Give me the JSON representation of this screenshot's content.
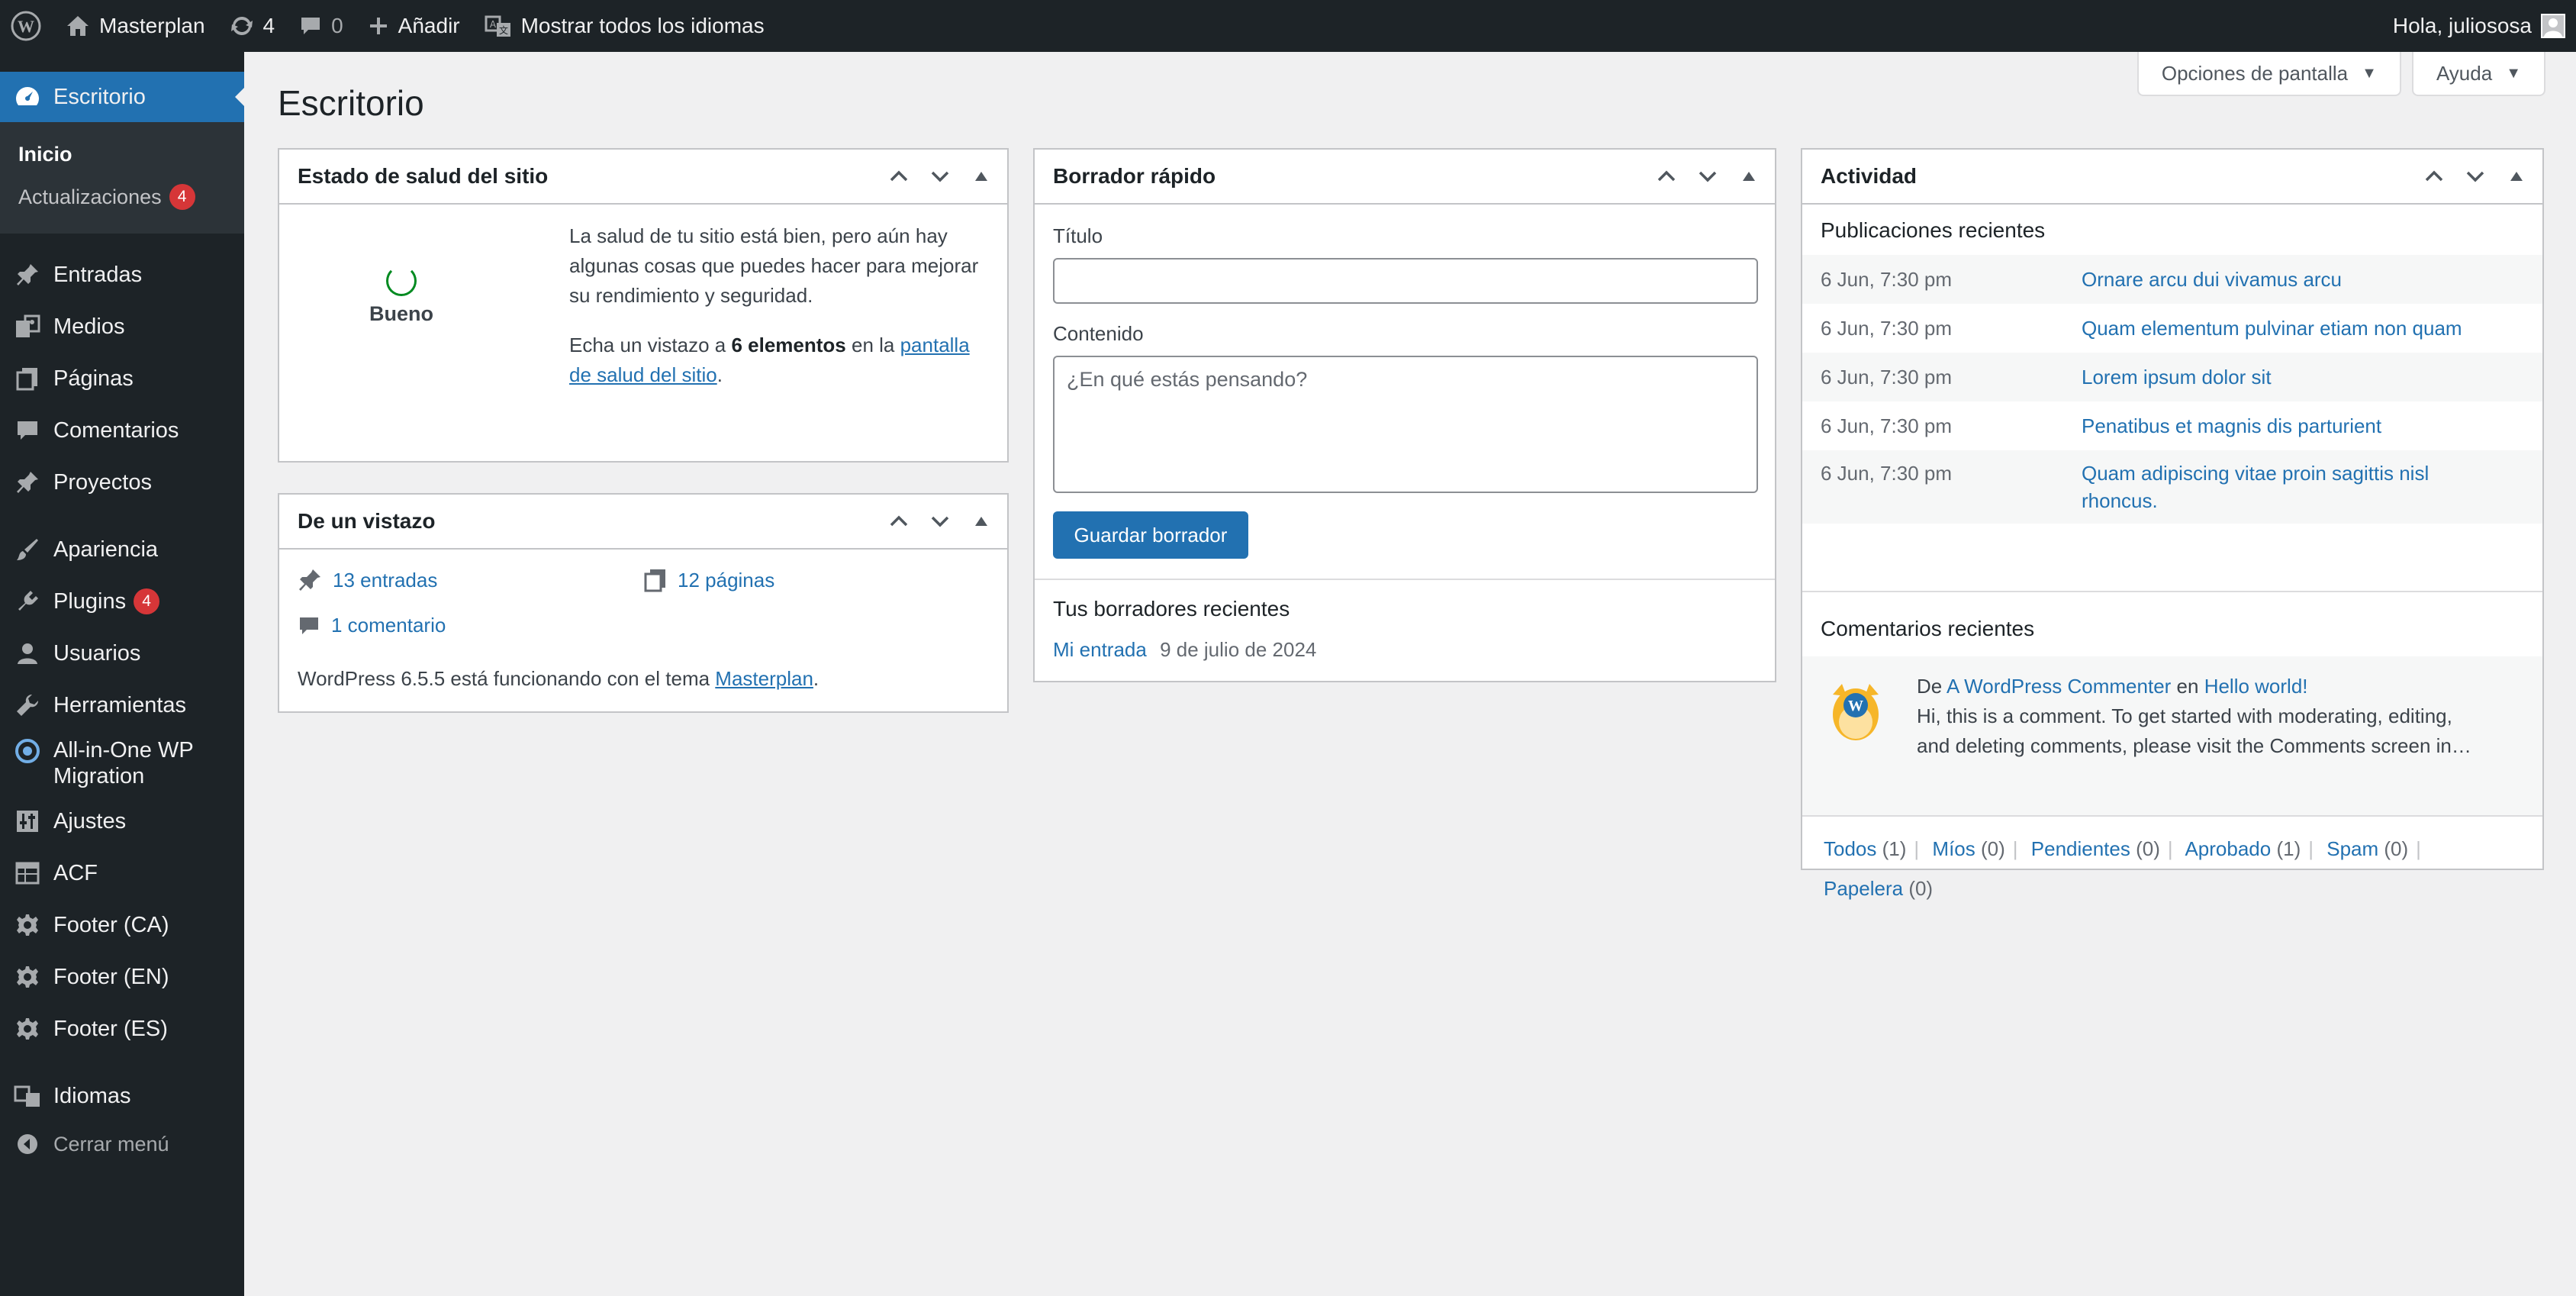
{
  "adminbar": {
    "site_name": "Masterplan",
    "updates_count": "4",
    "comments_count": "0",
    "add_new": "Añadir",
    "languages": "Mostrar todos los idiomas",
    "greeting": "Hola, juliososa"
  },
  "sidebar": {
    "dashboard": "Escritorio",
    "sub_home": "Inicio",
    "sub_updates": "Actualizaciones",
    "sub_updates_badge": "4",
    "items": [
      {
        "label": "Entradas",
        "icon": "pushpin-icon"
      },
      {
        "label": "Medios",
        "icon": "media-icon"
      },
      {
        "label": "Páginas",
        "icon": "pages-icon"
      },
      {
        "label": "Comentarios",
        "icon": "comments-icon"
      },
      {
        "label": "Proyectos",
        "icon": "pushpin-icon"
      },
      {
        "label": "Apariencia",
        "icon": "brush-icon"
      },
      {
        "label": "Plugins",
        "icon": "plugin-icon",
        "badge": "4"
      },
      {
        "label": "Usuarios",
        "icon": "user-icon"
      },
      {
        "label": "Herramientas",
        "icon": "wrench-icon"
      },
      {
        "label": "All-in-One WP Migration",
        "icon": "migration-icon"
      },
      {
        "label": "Ajustes",
        "icon": "settings-sliders-icon"
      },
      {
        "label": "ACF",
        "icon": "table-icon"
      },
      {
        "label": "Footer (CA)",
        "icon": "gear-icon"
      },
      {
        "label": "Footer (EN)",
        "icon": "gear-icon"
      },
      {
        "label": "Footer (ES)",
        "icon": "gear-icon"
      },
      {
        "label": "Idiomas",
        "icon": "translation-icon"
      }
    ],
    "collapse": "Cerrar menú"
  },
  "header": {
    "screen_options": "Opciones de pantalla",
    "help": "Ayuda",
    "title": "Escritorio"
  },
  "site_health": {
    "title": "Estado de salud del sitio",
    "status": "Bueno",
    "status_color": "#008a20",
    "description": "La salud de tu sitio está bien, pero aún hay algunas cosas que puedes hacer para mejorar su rendimiento y seguridad.",
    "cta_prefix": "Echa un vistazo a ",
    "cta_count": "6 elementos",
    "cta_middle": " en la ",
    "cta_link_line1": "pantalla",
    "cta_link_line2": "de salud del sitio",
    "cta_suffix": "."
  },
  "glance": {
    "title": "De un vistazo",
    "posts": "13 entradas",
    "pages": "12 páginas",
    "comments": "1 comentario",
    "version_prefix": "WordPress 6.5.5 está funcionando con el tema ",
    "theme": "Masterplan",
    "version_suffix": "."
  },
  "quick_draft": {
    "title": "Borrador rápido",
    "title_label": "Título",
    "title_value": "",
    "content_label": "Contenido",
    "content_placeholder": "¿En qué estás pensando?",
    "save_button": "Guardar borrador",
    "recent_drafts_title": "Tus borradores recientes",
    "draft_link": "Mi entrada",
    "draft_date": "9 de julio de 2024"
  },
  "activity": {
    "title": "Actividad",
    "recent_posts_title": "Publicaciones recientes",
    "posts": [
      {
        "date": "6 Jun, 7:30 pm",
        "title": "Ornare arcu dui vivamus arcu"
      },
      {
        "date": "6 Jun, 7:30 pm",
        "title": "Quam elementum pulvinar etiam non quam"
      },
      {
        "date": "6 Jun, 7:30 pm",
        "title": "Lorem ipsum dolor sit"
      },
      {
        "date": "6 Jun, 7:30 pm",
        "title": "Penatibus et magnis dis parturient"
      },
      {
        "date": "6 Jun, 7:30 pm",
        "title_line1": "Quam adipiscing vitae proin sagittis nisl",
        "title_line2": "rhoncus."
      }
    ],
    "recent_comments_title": "Comentarios recientes",
    "comment": {
      "prefix": "De ",
      "author": "A WordPress Commenter",
      "middle": " en ",
      "post": "Hello world!",
      "text_line1": "Hi, this is a comment. To get started with moderating, editing,",
      "text_line2": "and deleting comments, please visit the Comments screen in…"
    },
    "filters": [
      {
        "label": "Todos",
        "count": "(1)"
      },
      {
        "label": "Míos",
        "count": "(0)"
      },
      {
        "label": "Pendientes",
        "count": "(0)"
      },
      {
        "label": "Aprobado",
        "count": "(1)"
      },
      {
        "label": "Spam",
        "count": "(0)"
      },
      {
        "label": "Papelera",
        "count": "(0)"
      }
    ]
  }
}
